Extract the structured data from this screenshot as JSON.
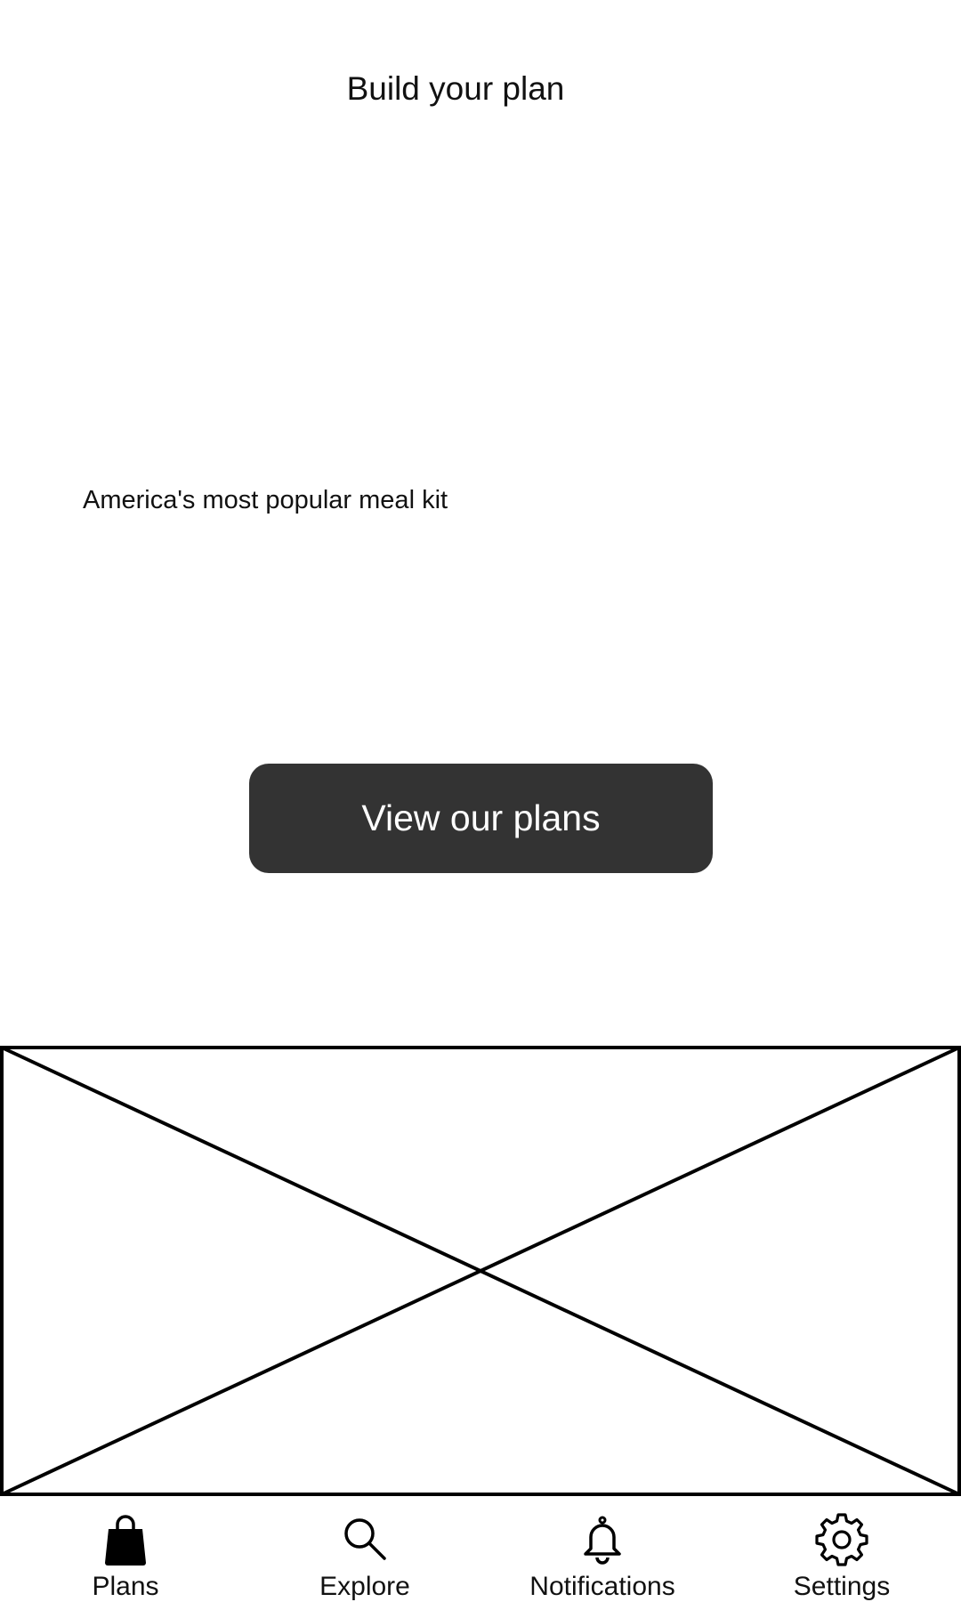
{
  "header": {
    "title": "Build your plan"
  },
  "hero": {
    "tagline": "America's most popular meal kit",
    "cta_label": "View our plans"
  },
  "colors": {
    "button_background": "#333333",
    "button_text": "#ffffff",
    "text": "#111111",
    "background": "#ffffff"
  },
  "tab_bar": {
    "items": [
      {
        "label": "Plans",
        "icon": "shopping-bag-icon"
      },
      {
        "label": "Explore",
        "icon": "search-icon"
      },
      {
        "label": "Notifications",
        "icon": "bell-icon"
      },
      {
        "label": "Settings",
        "icon": "gear-icon"
      }
    ]
  }
}
